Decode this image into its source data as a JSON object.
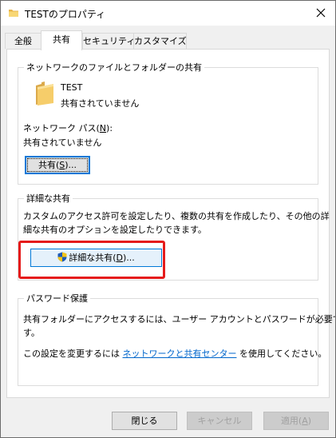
{
  "window": {
    "title": "TESTのプロパティ"
  },
  "tabs": [
    {
      "label": "全般",
      "active": false
    },
    {
      "label": "共有",
      "active": true
    },
    {
      "label": "セキュリティ",
      "active": false
    },
    {
      "label": "カスタマイズ",
      "active": false
    }
  ],
  "network_share": {
    "legend": "ネットワークのファイルとフォルダーの共有",
    "folder_name": "TEST",
    "folder_status": "共有されていません",
    "path_label_pre": "ネットワーク パス(",
    "path_label_key": "N",
    "path_label_post": "):",
    "path_value": "共有されていません",
    "share_button_pre": "共有(",
    "share_button_key": "S",
    "share_button_post": ")..."
  },
  "advanced_share": {
    "legend": "詳細な共有",
    "description_line1": "カスタムのアクセス許可を設定したり、複数の共有を作成したり、その他の詳",
    "description_line2": "細な共有のオプションを設定したりできます。",
    "button_pre": "詳細な共有(",
    "button_key": "D",
    "button_post": ")..."
  },
  "password": {
    "legend": "パスワード保護",
    "line1": "共有フォルダーにアクセスするには、ユーザー アカウントとパスワードが必要で",
    "line2": "す。",
    "change_pre": "この設定を変更するには ",
    "change_link": "ネットワークと共有センター",
    "change_post": " を使用してください。"
  },
  "footer": {
    "close_label": "閉じる",
    "cancel_label": "キャンセル",
    "apply_pre": "適用(",
    "apply_key": "A",
    "apply_post": ")"
  },
  "colors": {
    "highlight": "#e51b1b",
    "link": "#0066cc",
    "focus": "#0078d7",
    "folder": "#f2c55c"
  }
}
